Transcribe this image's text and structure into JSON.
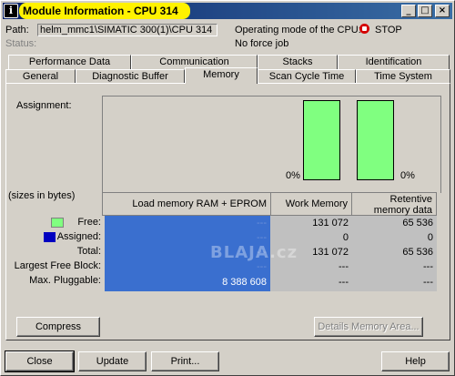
{
  "window": {
    "title": "Module Information - CPU 314",
    "system_icon": "i"
  },
  "path": {
    "label": "Path:",
    "value": "helm_mmc1\\SIMATIC 300(1)\\CPU 314"
  },
  "status": {
    "label": "Status:"
  },
  "operating_mode": {
    "label": "Operating mode of the CPU:",
    "value": "STOP",
    "icon": "stop-icon",
    "color": "#d40000"
  },
  "force_job": "No force job",
  "tabs_row1": [
    "Performance Data",
    "Communication",
    "Stacks",
    "Identification"
  ],
  "tabs_row2": [
    "General",
    "Diagnostic Buffer",
    "Memory",
    "Scan Cycle Time",
    "Time System"
  ],
  "active_tab": "Memory",
  "assignment_label": "Assignment:",
  "sizes_label": "(sizes in bytes)",
  "chart": {
    "bar1_label": "0%",
    "bar2_label": "0%",
    "bar_color": "#80ff80",
    "assigned_color": "#0000c0"
  },
  "table": {
    "columns": [
      "Load memory RAM + EPROM",
      "Work Memory",
      "Retentive memory data"
    ],
    "rows": [
      {
        "label": "Free:",
        "values": [
          "---",
          "131 072",
          "65 536"
        ]
      },
      {
        "label": "Assigned:",
        "values": [
          "---",
          "0",
          "0"
        ]
      },
      {
        "label": "Total:",
        "values": [
          "---",
          "131 072",
          "65 536"
        ]
      },
      {
        "label": "Largest Free Block:",
        "values": [
          "---",
          "---",
          "---"
        ]
      },
      {
        "label": "Max. Pluggable:",
        "values": [
          "8 388 608",
          "---",
          "---"
        ]
      }
    ],
    "selected_color": "#3a6fcf",
    "grey_color": "#c0c0c0"
  },
  "watermark": "BLAJA.cz",
  "buttons": {
    "compress": "Compress",
    "details": "Details Memory Area...",
    "close": "Close",
    "update": "Update",
    "print": "Print...",
    "help": "Help"
  }
}
